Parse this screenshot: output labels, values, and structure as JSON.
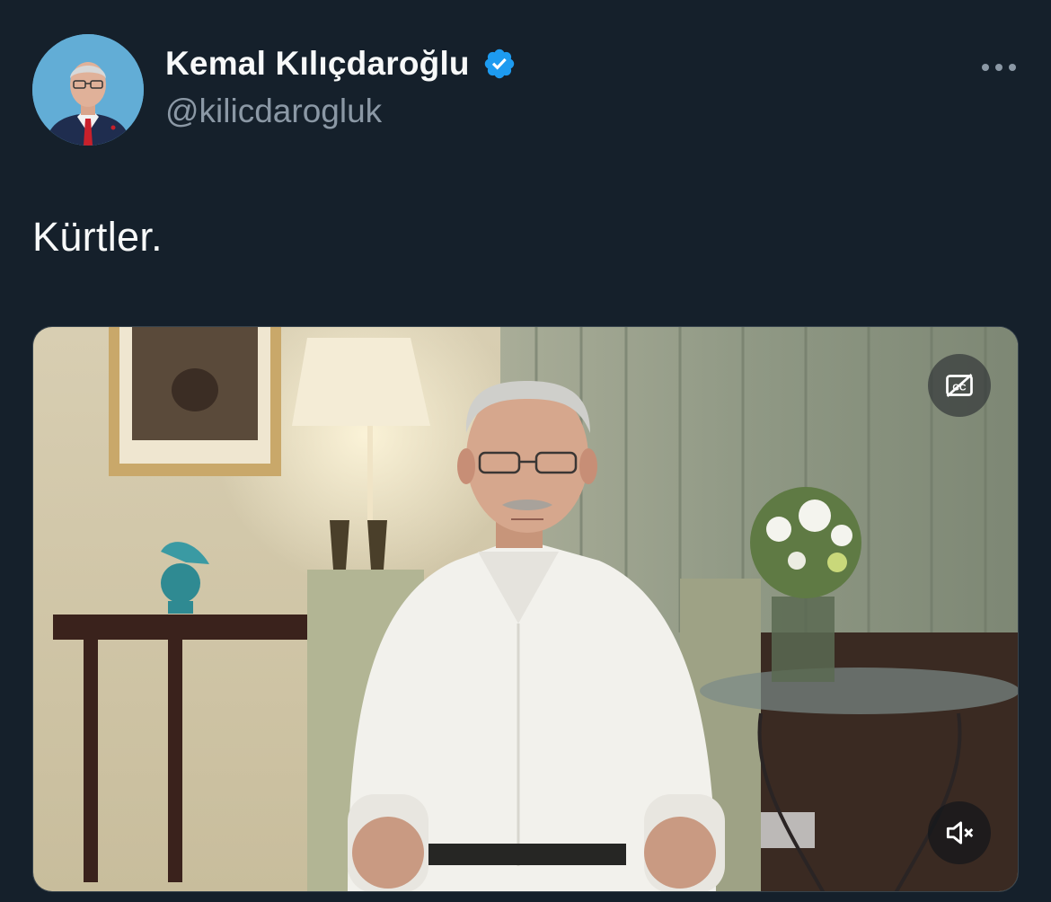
{
  "author": {
    "display_name": "Kemal Kılıçdaroğlu",
    "handle": "@kilicdarogluk",
    "verified": true,
    "verified_color": "#1d9bf0",
    "avatar_icon": "profile-photo"
  },
  "more_icon": "more-horizontal-icon",
  "tweet": {
    "text": "Kürtler."
  },
  "media": {
    "type": "video",
    "captions_icon": "captions-off-icon",
    "mute_icon": "volume-muted-icon"
  },
  "colors": {
    "background": "#15202b",
    "text_primary": "#f7f9f9",
    "text_secondary": "#8b98a5",
    "border": "#38444d"
  }
}
